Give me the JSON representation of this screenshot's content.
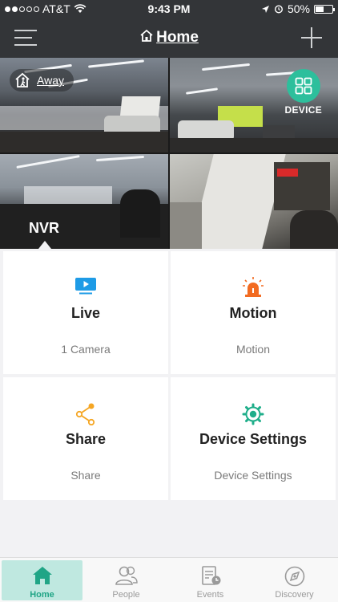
{
  "status_bar": {
    "carrier": "AT&T",
    "time": "9:43 PM",
    "battery": "50%",
    "battery_level": 0.5,
    "signal_bars_filled": 2,
    "signal_bars_total": 5
  },
  "nav": {
    "title": "Home",
    "menu_icon": "hamburger-icon",
    "add_icon": "plus-icon"
  },
  "camera_view": {
    "mode_label": "Away",
    "device_label": "DEVICE",
    "nvr_label": "NVR"
  },
  "tiles": [
    {
      "title": "Live",
      "subtitle": "1 Camera",
      "icon": "monitor-play-icon",
      "color": "#1e9be6"
    },
    {
      "title": "Motion",
      "subtitle": "Motion",
      "icon": "alarm-light-icon",
      "color": "#f26b21"
    },
    {
      "title": "Share",
      "subtitle": "Share",
      "icon": "share-icon",
      "color": "#f5a623"
    },
    {
      "title": "Device Settings",
      "subtitle": "Device Settings",
      "icon": "gear-icon",
      "color": "#1fae8a"
    }
  ],
  "tabs": [
    {
      "label": "Home",
      "icon": "home-icon",
      "active": true
    },
    {
      "label": "People",
      "icon": "people-icon",
      "active": false
    },
    {
      "label": "Events",
      "icon": "events-icon",
      "active": false
    },
    {
      "label": "Discovery",
      "icon": "discovery-icon",
      "active": false
    }
  ],
  "colors": {
    "accent": "#2dbf9c",
    "topbar": "#333538",
    "tab_active_bg": "#bfe8e0"
  }
}
